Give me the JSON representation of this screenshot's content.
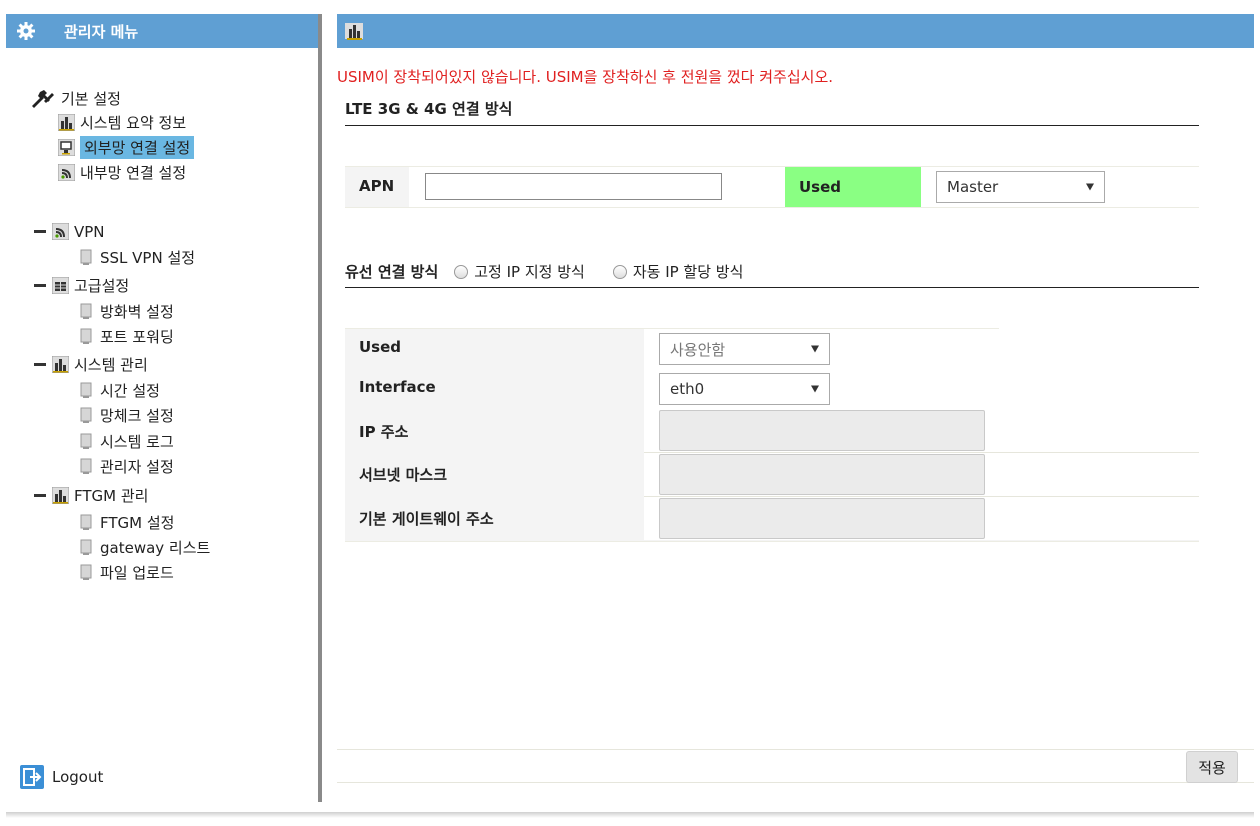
{
  "sidebar": {
    "title": "관리자 메뉴",
    "basic_label": "기본 설정",
    "basic_items": [
      "시스템 요약 정보",
      "외부망 연결 설정",
      "내부망 연결 설정"
    ],
    "groups": [
      {
        "label": "VPN",
        "items": [
          "SSL VPN 설정"
        ]
      },
      {
        "label": "고급설정",
        "items": [
          "방화벽 설정",
          "포트 포워딩"
        ]
      },
      {
        "label": "시스템 관리",
        "items": [
          "시간 설정",
          "망체크 설정",
          "시스템 로그",
          "관리자 설정"
        ]
      },
      {
        "label": "FTGM 관리",
        "items": [
          "FTGM 설정",
          "gateway 리스트",
          "파일 업로드"
        ]
      }
    ],
    "logout": "Logout"
  },
  "main": {
    "warning": "USIM이 장착되어있지 않습니다. USIM을 장착하신 후 전원을 껐다 켜주십시오.",
    "lte_title": "LTE 3G & 4G 연결 방식",
    "apn_label": "APN",
    "apn_value": "",
    "used_label": "Used",
    "used_select": "Master",
    "wired_title": "유선 연결 방식",
    "radio_static": "고정 IP 지정 방식",
    "radio_auto": "자동 IP 할당 방식",
    "wired": {
      "used_label": "Used",
      "used_value": "사용안함",
      "interface_label": "Interface",
      "interface_value": "eth0",
      "ip_label": "IP 주소",
      "subnet_label": "서브넷 마스크",
      "gateway_label": "기본 게이트웨이 주소"
    },
    "apply": "적용"
  },
  "colors": {
    "header": "#5f9fd3",
    "selected": "#6ab7e2",
    "used_green": "#8aff83",
    "warning": "#e02020"
  }
}
